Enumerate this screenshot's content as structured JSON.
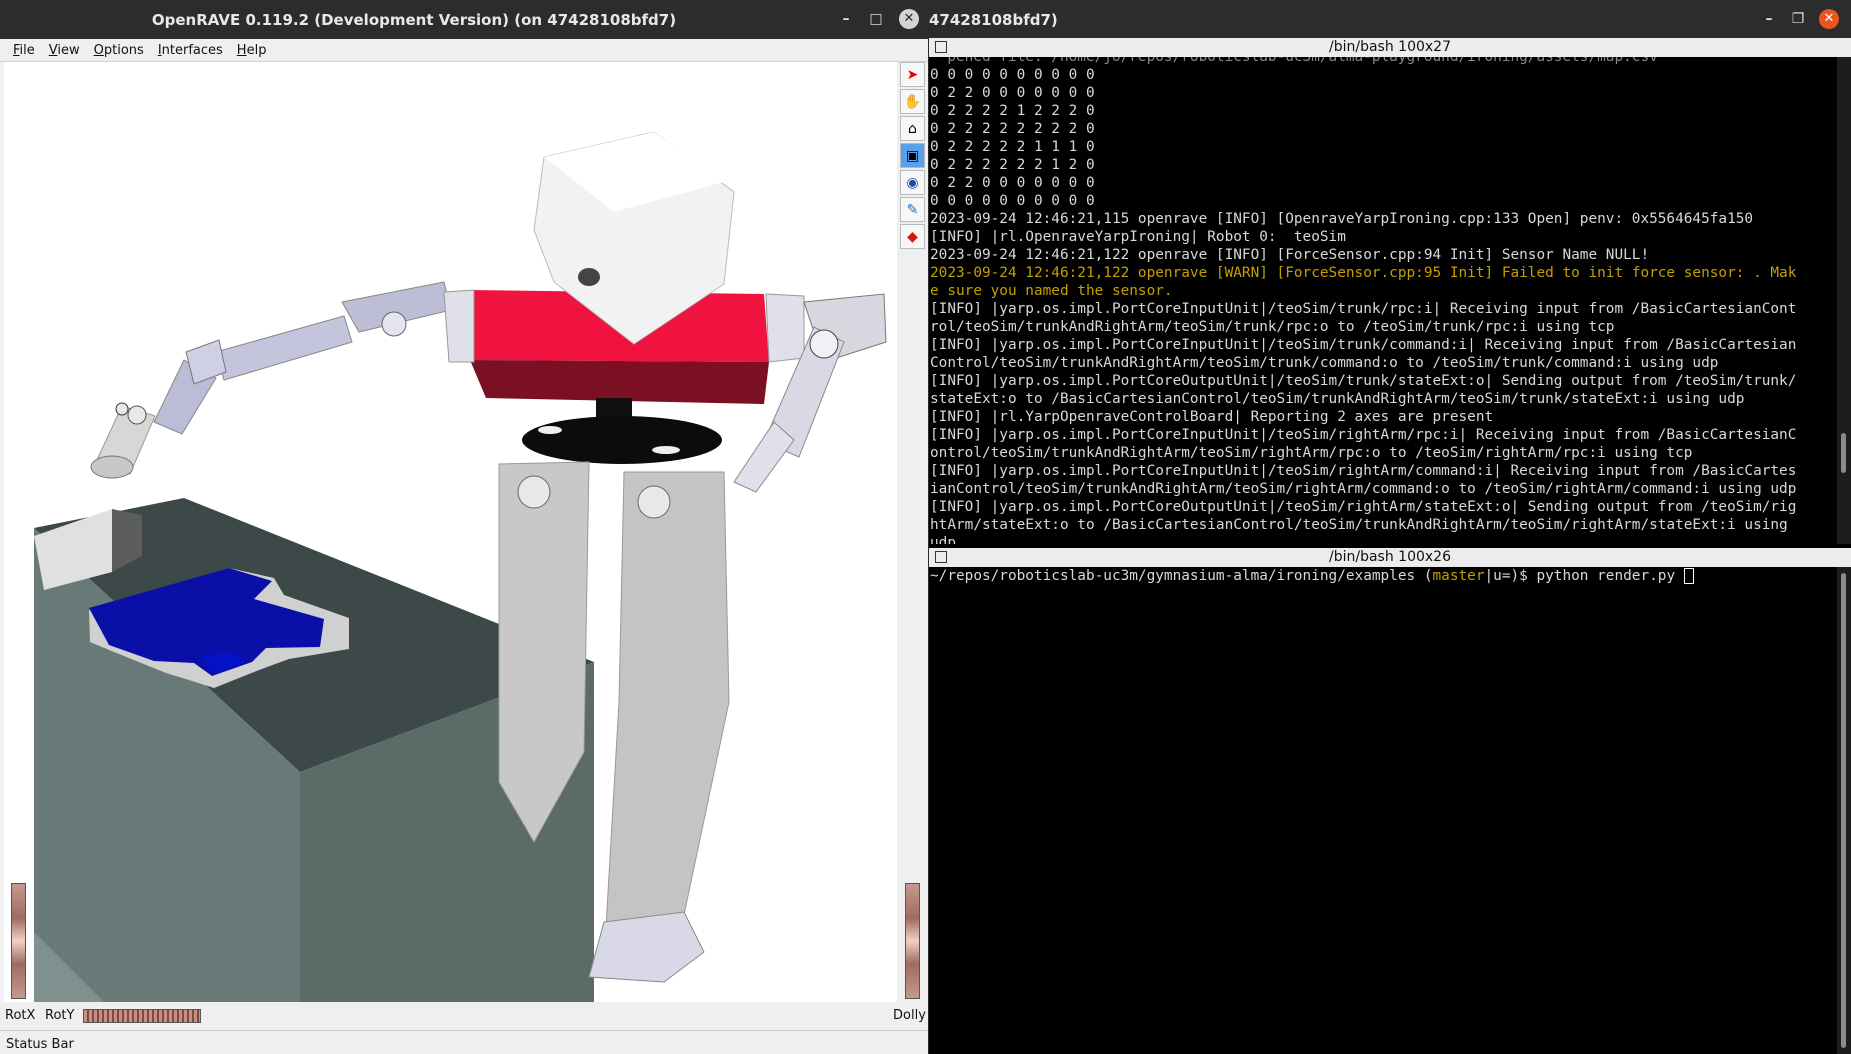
{
  "openrave": {
    "title": "OpenRAVE 0.119.2 (Development Version) (on 47428108bfd7)",
    "menu": [
      "File",
      "View",
      "Options",
      "Interfaces",
      "Help"
    ],
    "tools": [
      "select-arrow-icon",
      "pan-hand-icon",
      "home-icon",
      "viewall-icon",
      "eye-icon",
      "seek-icon",
      "perspective-icon"
    ],
    "bottom": {
      "rotx": "RotX",
      "roty": "RotY",
      "dolly": "Dolly"
    },
    "status": "Status Bar",
    "colors": {
      "torso": "#f0123f",
      "table": "#5f716e",
      "cloth": "#0a0fa8"
    }
  },
  "terminal": {
    "title": "47428108bfd7)",
    "top_pane": {
      "header": "/bin/bash 100x27",
      "lines": [
        {
          "t": "  pened file: /home/jo/repos/roboticslab-uc3m/alma-playground/ironing/assets/map.csv",
          "c": "partial"
        },
        {
          "t": "0 0 0 0 0 0 0 0 0 0"
        },
        {
          "t": "0 2 2 0 0 0 0 0 0 0"
        },
        {
          "t": "0 2 2 2 2 1 2 2 2 0"
        },
        {
          "t": "0 2 2 2 2 2 2 2 2 0"
        },
        {
          "t": "0 2 2 2 2 2 1 1 1 0"
        },
        {
          "t": "0 2 2 2 2 2 2 1 2 0"
        },
        {
          "t": "0 2 2 0 0 0 0 0 0 0"
        },
        {
          "t": "0 0 0 0 0 0 0 0 0 0"
        },
        {
          "t": "2023-09-24 12:46:21,115 openrave [INFO] [OpenraveYarpIroning.cpp:133 Open] penv: 0x5564645fa150"
        },
        {
          "t": "[INFO] |rl.OpenraveYarpIroning| Robot 0:  teoSim"
        },
        {
          "t": "2023-09-24 12:46:21,122 openrave [INFO] [ForceSensor.cpp:94 Init] Sensor Name NULL!"
        },
        {
          "t": "2023-09-24 12:46:21,122 openrave [WARN] [ForceSensor.cpp:95 Init] Failed to init force sensor: . Mak",
          "c": "warn"
        },
        {
          "t": "e sure you named the sensor.",
          "c": "warn"
        },
        {
          "t": "[INFO] |yarp.os.impl.PortCoreInputUnit|/teoSim/trunk/rpc:i| Receiving input from /BasicCartesianCont"
        },
        {
          "t": "rol/teoSim/trunkAndRightArm/teoSim/trunk/rpc:o to /teoSim/trunk/rpc:i using tcp"
        },
        {
          "t": "[INFO] |yarp.os.impl.PortCoreInputUnit|/teoSim/trunk/command:i| Receiving input from /BasicCartesian"
        },
        {
          "t": "Control/teoSim/trunkAndRightArm/teoSim/trunk/command:o to /teoSim/trunk/command:i using udp"
        },
        {
          "t": "[INFO] |yarp.os.impl.PortCoreOutputUnit|/teoSim/trunk/stateExt:o| Sending output from /teoSim/trunk/"
        },
        {
          "t": "stateExt:o to /BasicCartesianControl/teoSim/trunkAndRightArm/teoSim/trunk/stateExt:i using udp"
        },
        {
          "t": "[INFO] |rl.YarpOpenraveControlBoard| Reporting 2 axes are present"
        },
        {
          "t": "[INFO] |yarp.os.impl.PortCoreInputUnit|/teoSim/rightArm/rpc:i| Receiving input from /BasicCartesianC"
        },
        {
          "t": "ontrol/teoSim/trunkAndRightArm/teoSim/rightArm/rpc:o to /teoSim/rightArm/rpc:i using tcp"
        },
        {
          "t": "[INFO] |yarp.os.impl.PortCoreInputUnit|/teoSim/rightArm/command:i| Receiving input from /BasicCartes"
        },
        {
          "t": "ianControl/teoSim/trunkAndRightArm/teoSim/rightArm/command:o to /teoSim/rightArm/command:i using udp"
        },
        {
          "t": "[INFO] |yarp.os.impl.PortCoreOutputUnit|/teoSim/rightArm/stateExt:o| Sending output from /teoSim/rig"
        },
        {
          "t": "htArm/stateExt:o to /BasicCartesianControl/teoSim/trunkAndRightArm/teoSim/rightArm/stateExt:i using"
        },
        {
          "t": "udp"
        }
      ]
    },
    "bottom_pane": {
      "header": "/bin/bash 100x26",
      "prompt_path": "~/repos/roboticslab-uc3m/gymnasium-alma/ironing/examples (",
      "branch": "master",
      "prompt_tail": "|u=)$ python render.py "
    }
  }
}
